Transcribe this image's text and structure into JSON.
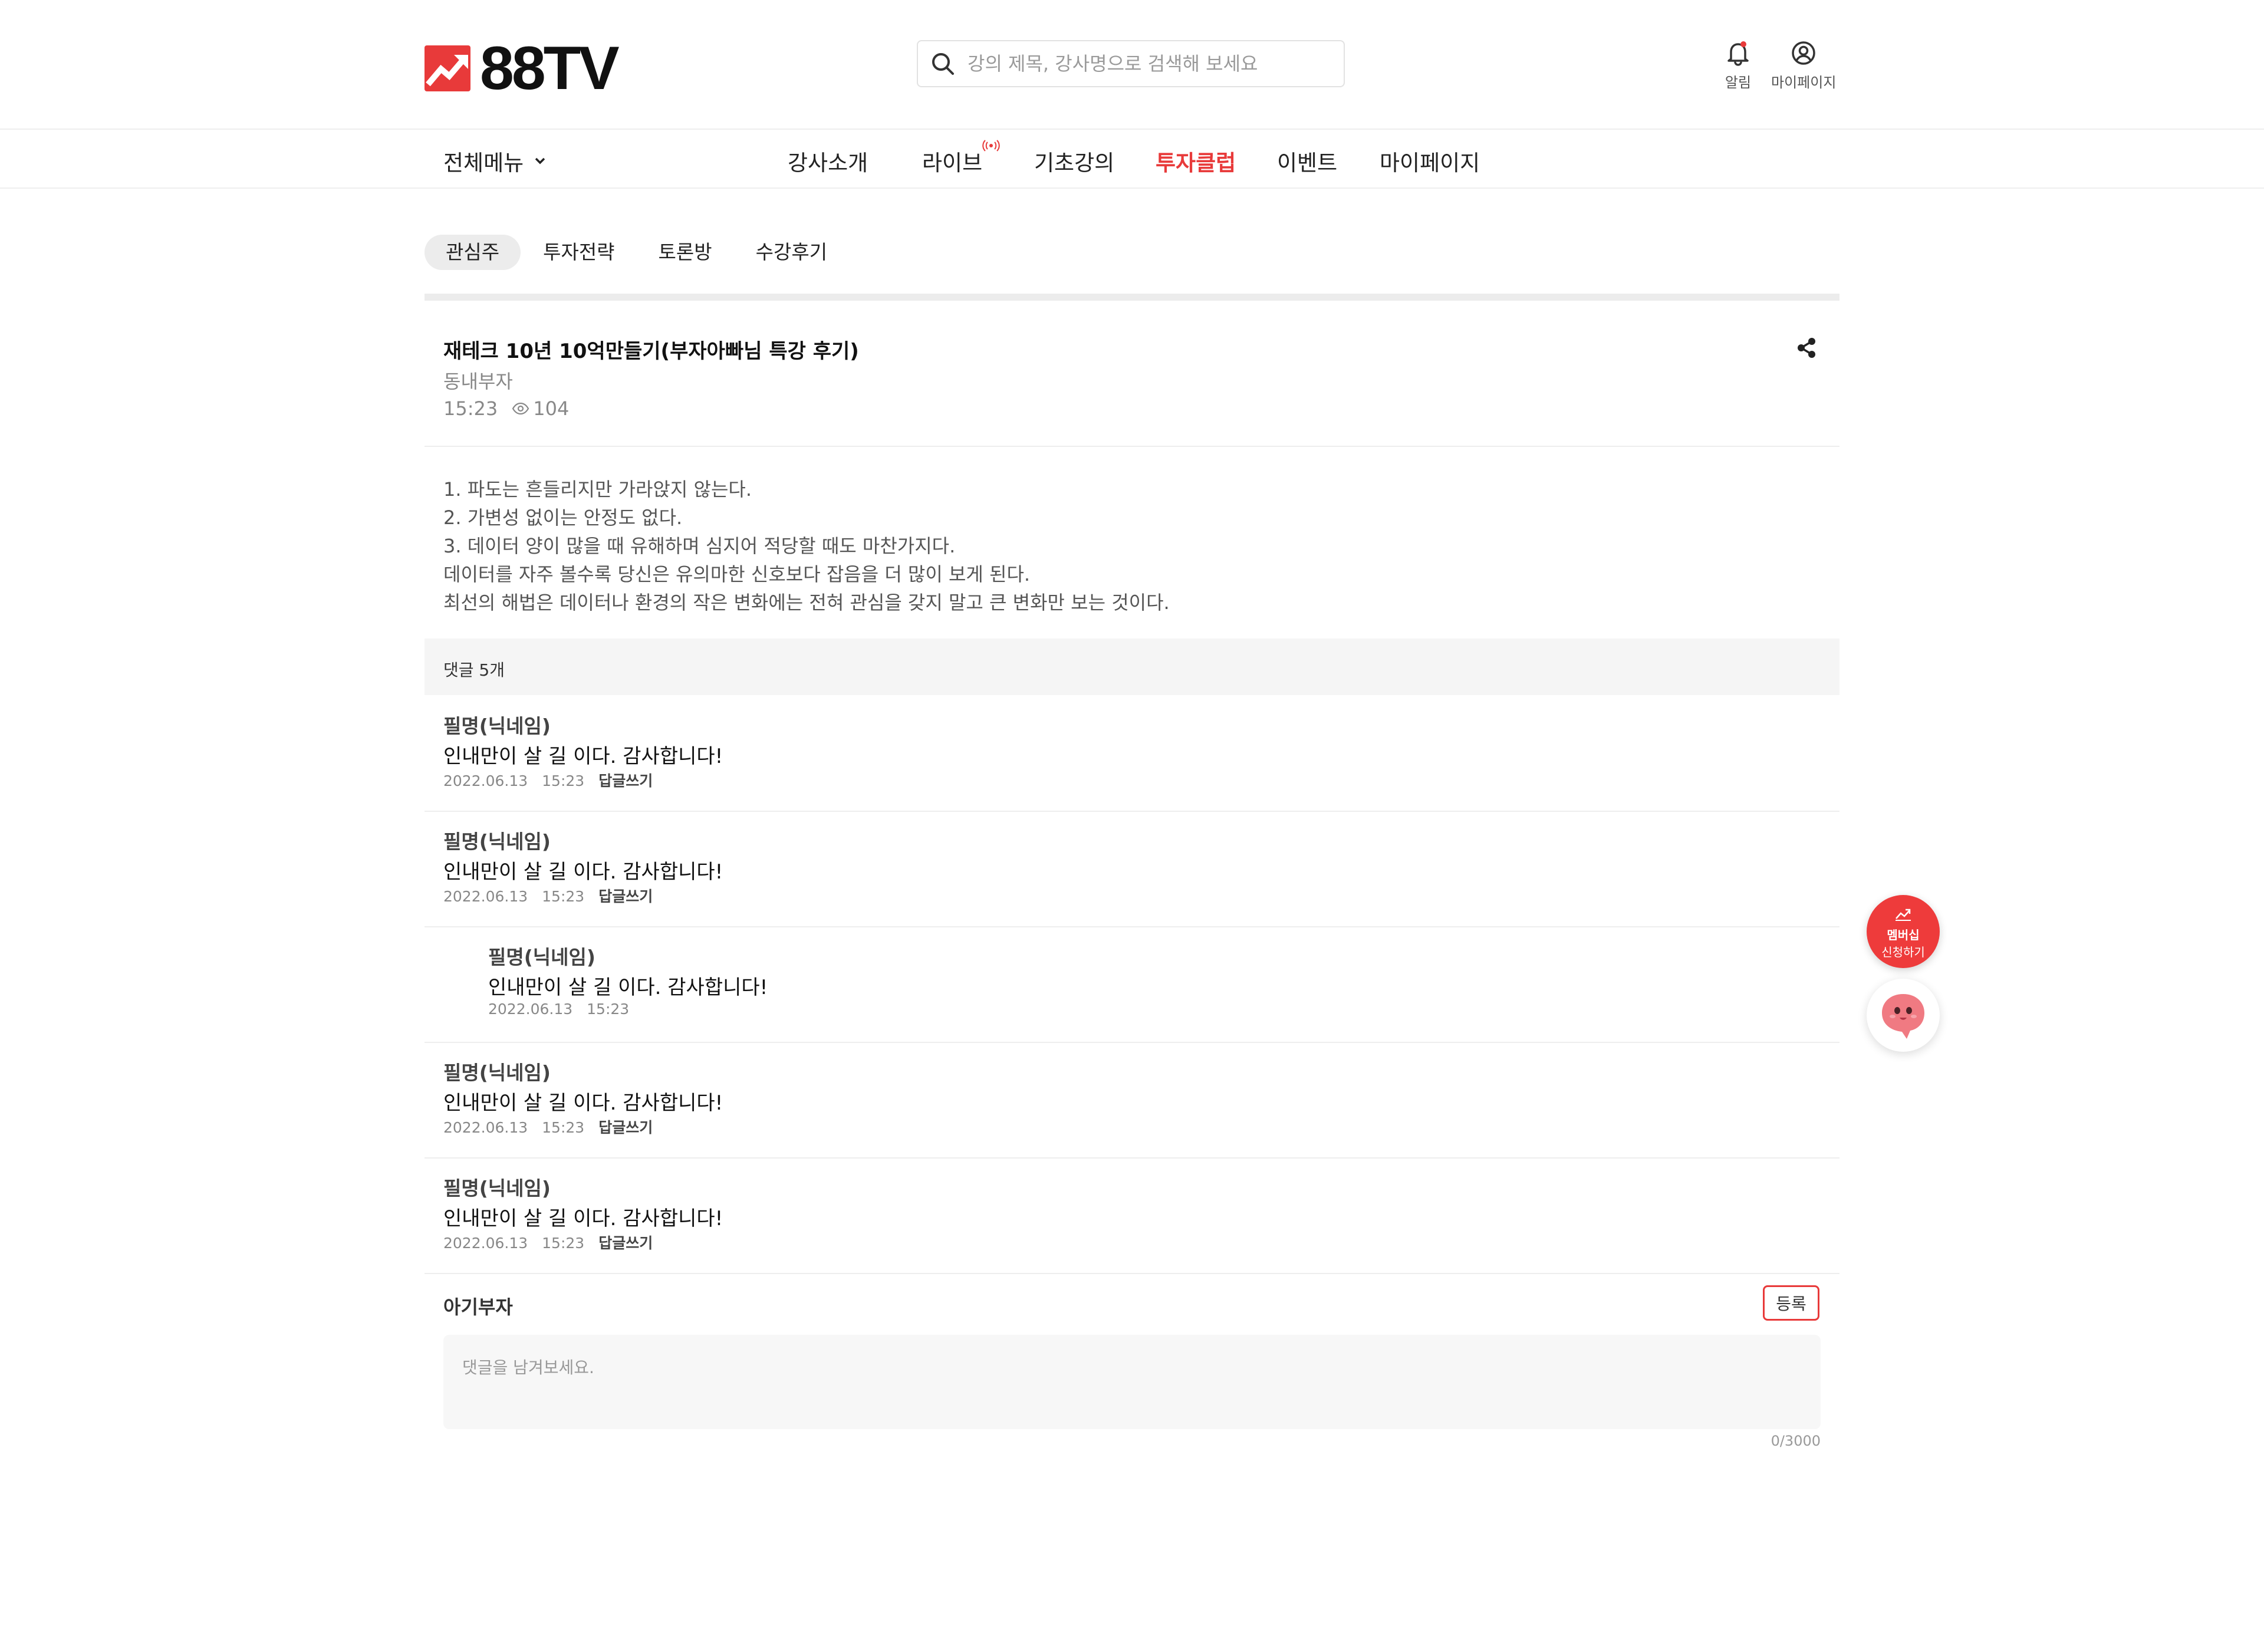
{
  "header": {
    "logo_text": "88TV",
    "search_placeholder": "강의 제목, 강사명으로 검색해 보세요",
    "alarm_label": "알림",
    "mypage_label": "마이페이지"
  },
  "nav": {
    "all_menu": "전체메뉴",
    "items": [
      "강사소개",
      "라이브",
      "기초강의",
      "투자클럽",
      "이벤트",
      "마이페이지"
    ],
    "active_item": "투자클럽",
    "live_badge_icon": "broadcast-icon"
  },
  "tabs": [
    "관심주",
    "투자전략",
    "토론방",
    "수강후기"
  ],
  "selected_tab": "관심주",
  "post": {
    "title": "재테크 10년 10억만들기(부자아빠님 특강 후기)",
    "author": "동내부자",
    "time": "15:23",
    "views": "104",
    "body": [
      "1. 파도는 흔들리지만 가라앉지 않는다.",
      "2. 가변성 없이는 안정도 없다.",
      "3. 데이터 양이 많을 때 유해하며 심지어 적당할 때도 마찬가지다.",
      "데이터를 자주 볼수록 당신은 유의마한 신호보다 잡음을 더 많이 보게 된다.",
      "최선의 해법은 데이터나 환경의 작은 변화에는 전혀 관심을 갖지 말고 큰 변화만 보는 것이다."
    ]
  },
  "comments": {
    "count_label": "댓글 5개",
    "reply_label": "답글쓰기",
    "items": [
      {
        "name": "필명(닉네임)",
        "text": "인내만이 살 길 이다. 감사합니다!",
        "date": "2022.06.13",
        "time": "15:23"
      },
      {
        "name": "필명(닉네임)",
        "text": "인내만이 살 길 이다. 감사합니다!",
        "date": "2022.06.13",
        "time": "15:23"
      },
      {
        "name": "필명(닉네임)",
        "text": "인내만이 살 길 이다. 감사합니다!",
        "date": "2022.06.13",
        "time": "15:23"
      },
      {
        "name": "필명(닉네임)",
        "text": "인내만이 살 길 이다. 감사합니다!",
        "date": "2022.06.13",
        "time": "15:23"
      },
      {
        "name": "필명(닉네임)",
        "text": "인내만이 살 길 이다. 감사합니다!",
        "date": "2022.06.13",
        "time": "15:23"
      }
    ]
  },
  "write": {
    "user": "아기부자",
    "submit_label": "등록",
    "placeholder": "댓글을 남겨보세요.",
    "counter": "0/3000"
  },
  "fab": {
    "membership_line1": "멤버십",
    "membership_line2": "신청하기",
    "chatbot_icon": "chat-character-icon"
  },
  "colors": {
    "accent": "#e83a3a",
    "tab_bg": "#ececec",
    "comment_bar_bg": "#f5f5f5"
  }
}
